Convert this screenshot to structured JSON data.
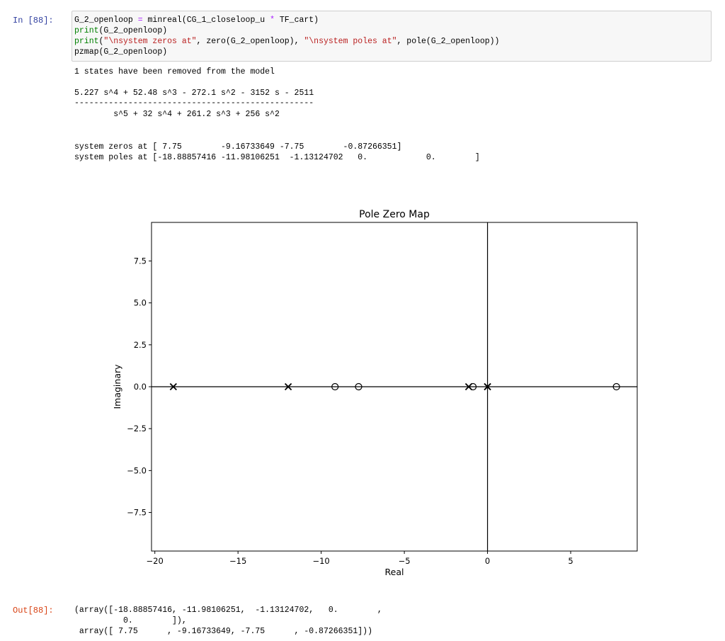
{
  "cell_in": {
    "prompt": "In [88]:",
    "code": {
      "line1": {
        "pre": "G_2_openloop ",
        "op": "=",
        "post": " minreal(CG_1_closeloop_u ",
        "op2": "*",
        "post2": " TF_cart)"
      },
      "line2": {
        "kw": "print",
        "rest": "(G_2_openloop)"
      },
      "line3": {
        "kw": "print",
        "p1": "(",
        "s1": "\"\\nsystem zeros at\"",
        "p2": ", zero(G_2_openloop), ",
        "s2": "\"\\nsystem poles at\"",
        "p3": ", pole(G_2_openloop))"
      },
      "line4": "pzmap(G_2_openloop)"
    }
  },
  "stdout": {
    "removed": "1 states have been removed from the model",
    "numerator": "5.227 s^4 + 52.48 s^3 - 272.1 s^2 - 3152 s - 2511",
    "divider": "-------------------------------------------------",
    "denominator": "        s^5 + 32 s^4 + 261.2 s^3 + 256 s^2",
    "zeros": "system zeros at [ 7.75        -9.16733649 -7.75        -0.87266351]",
    "poles": "system poles at [-18.88857416 -11.98106251  -1.13124702   0.            0.        ]"
  },
  "chart_data": {
    "type": "scatter",
    "title": "Pole Zero Map",
    "xlabel": "Real",
    "ylabel": "Imaginary",
    "xlim": [
      -20.2,
      9.0
    ],
    "ylim": [
      -9.8,
      9.8
    ],
    "xticks": [
      -20,
      -15,
      -10,
      -5,
      0,
      5
    ],
    "xtick_labels": [
      "−20",
      "−15",
      "−10",
      "−5",
      "0",
      "5"
    ],
    "yticks": [
      -7.5,
      -5.0,
      -2.5,
      0.0,
      2.5,
      5.0,
      7.5
    ],
    "ytick_labels": [
      "−7.5",
      "−5.0",
      "−2.5",
      "0.0",
      "2.5",
      "5.0",
      "7.5"
    ],
    "grid": false,
    "series": [
      {
        "marker": "x",
        "points": [
          [
            -18.88857416,
            0
          ],
          [
            -11.98106251,
            0
          ],
          [
            -1.13124702,
            0
          ],
          [
            0,
            0
          ],
          [
            0,
            0
          ]
        ]
      },
      {
        "marker": "o",
        "points": [
          [
            7.75,
            0
          ],
          [
            -9.16733649,
            0
          ],
          [
            -7.75,
            0
          ],
          [
            -0.87266351,
            0
          ]
        ]
      }
    ]
  },
  "cell_out": {
    "prompt": "Out[88]:",
    "line1": "(array([-18.88857416, -11.98106251,  -1.13124702,   0.        ,",
    "line2": "          0.        ]),",
    "line3": " array([ 7.75      , -9.16733649, -7.75      , -0.87266351]))"
  }
}
